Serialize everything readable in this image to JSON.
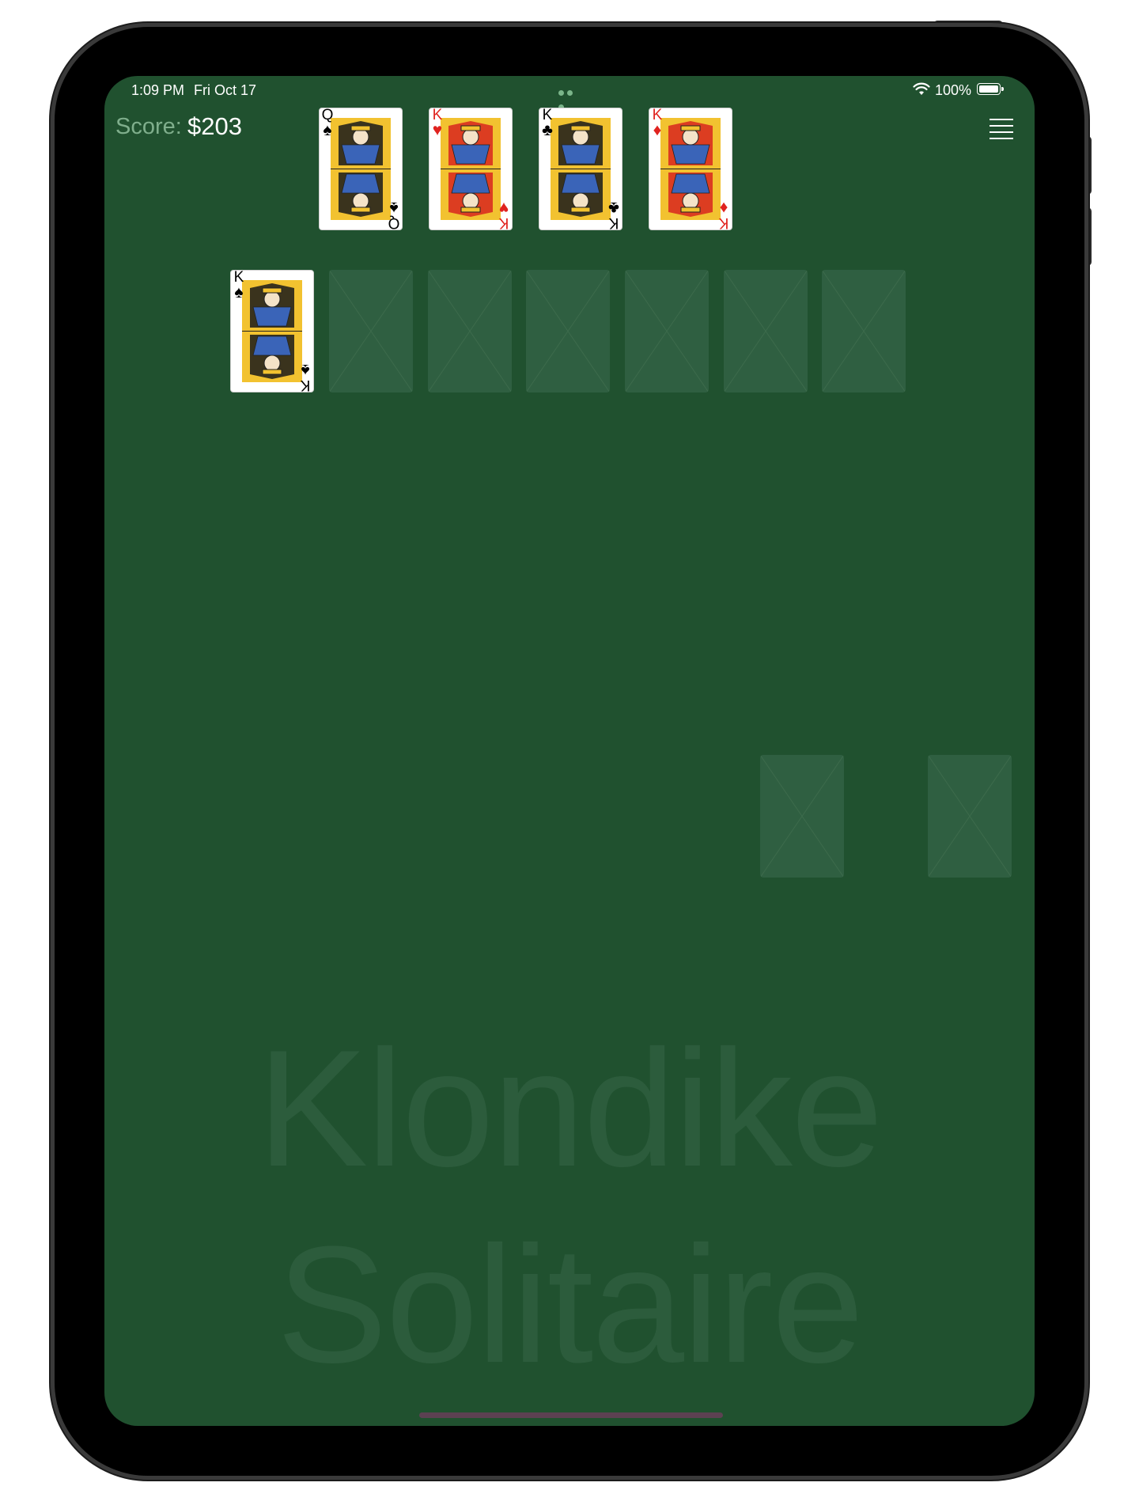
{
  "status_bar": {
    "time": "1:09 PM",
    "date": "Fri Oct 17",
    "battery": "100%"
  },
  "score": {
    "label": "Score:",
    "value": "$203"
  },
  "foundation": [
    {
      "rank": "Q",
      "suit": "♠",
      "color": "black"
    },
    {
      "rank": "K",
      "suit": "♥",
      "color": "red"
    },
    {
      "rank": "K",
      "suit": "♣",
      "color": "black"
    },
    {
      "rank": "K",
      "suit": "♦",
      "color": "red"
    }
  ],
  "tableau": [
    {
      "rank": "K",
      "suit": "♠",
      "color": "black"
    }
  ],
  "watermark": {
    "line1": "Klondike",
    "line2": "Solitaire"
  },
  "colors": {
    "felt": "#20512f",
    "empty_slot": "#2f5f41",
    "watermark_text": "#2c5c3c"
  },
  "icons": [
    "wifi-icon",
    "battery-icon",
    "menu-icon",
    "multitask-dots-icon"
  ]
}
